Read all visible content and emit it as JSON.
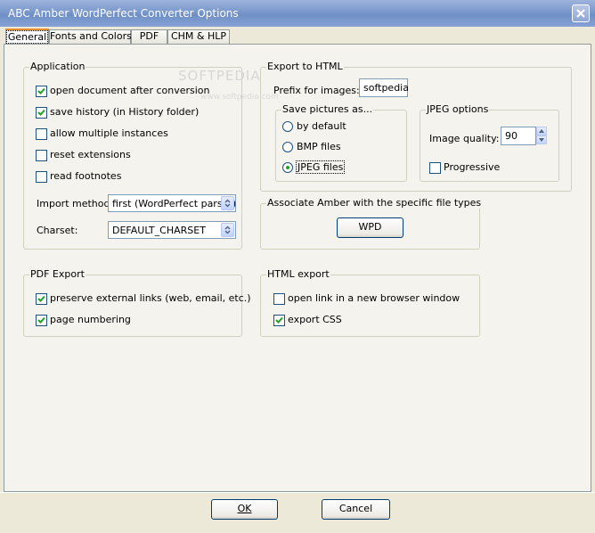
{
  "window": {
    "title": "ABC Amber WordPerfect Converter Options"
  },
  "tabs": [
    {
      "label": "General",
      "active": true
    },
    {
      "label": "Fonts and Colors",
      "active": false
    },
    {
      "label": "PDF",
      "active": false
    },
    {
      "label": "CHM & HLP",
      "active": false
    }
  ],
  "watermark": {
    "logo": "SOFTPEDIA",
    "url": "www.softpedia.com"
  },
  "application": {
    "legend": "Application",
    "checkboxes": [
      {
        "label": "open document after conversion",
        "checked": true
      },
      {
        "label": "save history (in History folder)",
        "checked": true
      },
      {
        "label": "allow multiple instances",
        "checked": false
      },
      {
        "label": "reset extensions",
        "checked": false
      },
      {
        "label": "read footnotes",
        "checked": false
      }
    ],
    "import_method": {
      "label": "Import method:",
      "value": "first (WordPerfect parser)"
    },
    "charset": {
      "label": "Charset:",
      "value": "DEFAULT_CHARSET"
    }
  },
  "export_html": {
    "legend": "Export to HTML",
    "prefix_label": "Prefix for images:",
    "prefix_value": "softpedia",
    "save_pictures": {
      "legend": "Save pictures as...",
      "options": [
        {
          "label": "by default",
          "selected": false
        },
        {
          "label": "BMP files",
          "selected": false
        },
        {
          "label": "JPEG files",
          "selected": true
        }
      ]
    },
    "jpeg_options": {
      "legend": "JPEG options",
      "quality_label": "Image quality:",
      "quality_value": "90",
      "progressive_label": "Progressive",
      "progressive_checked": false
    }
  },
  "associate": {
    "legend": "Associate Amber with the specific file types",
    "button": "WPD"
  },
  "pdf_export": {
    "legend": "PDF Export",
    "checkboxes": [
      {
        "label": "preserve external links (web, email, etc.)",
        "checked": true
      },
      {
        "label": "page numbering",
        "checked": true
      }
    ]
  },
  "html_export": {
    "legend": "HTML export",
    "checkboxes": [
      {
        "label": "open link in a new browser window",
        "checked": false
      },
      {
        "label": "export CSS",
        "checked": true
      }
    ]
  },
  "buttons": {
    "ok": "OK",
    "cancel": "Cancel"
  }
}
